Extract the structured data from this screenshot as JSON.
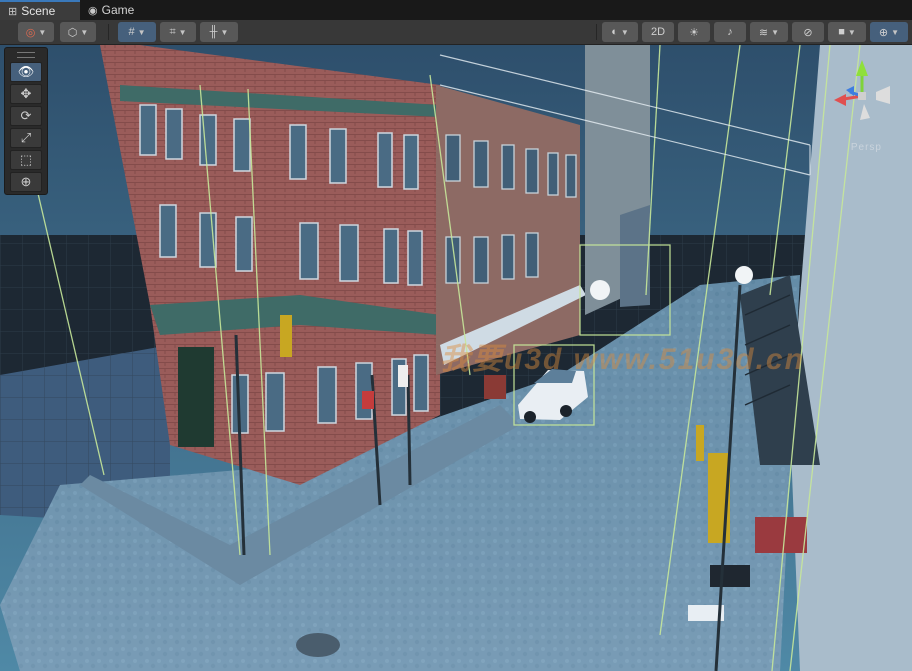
{
  "tabs": [
    {
      "label": "Scene",
      "icon": "grid-icon",
      "active": true
    },
    {
      "label": "Game",
      "icon": "gamepad-icon",
      "active": false
    }
  ],
  "toolbar": {
    "toggle_2d_label": "2D"
  },
  "tools": [
    {
      "name": "view-tool",
      "glyph": "👁"
    },
    {
      "name": "move-tool",
      "glyph": "✥"
    },
    {
      "name": "rotate-tool",
      "glyph": "⟳"
    },
    {
      "name": "scale-tool",
      "glyph": "⤢"
    },
    {
      "name": "rect-tool",
      "glyph": "⬚"
    },
    {
      "name": "transform-tool",
      "glyph": "⊕"
    }
  ],
  "gizmo": {
    "label": "Persp"
  },
  "watermark": "我要u3d www.51u3d.cn",
  "accent": "#3a79bb"
}
